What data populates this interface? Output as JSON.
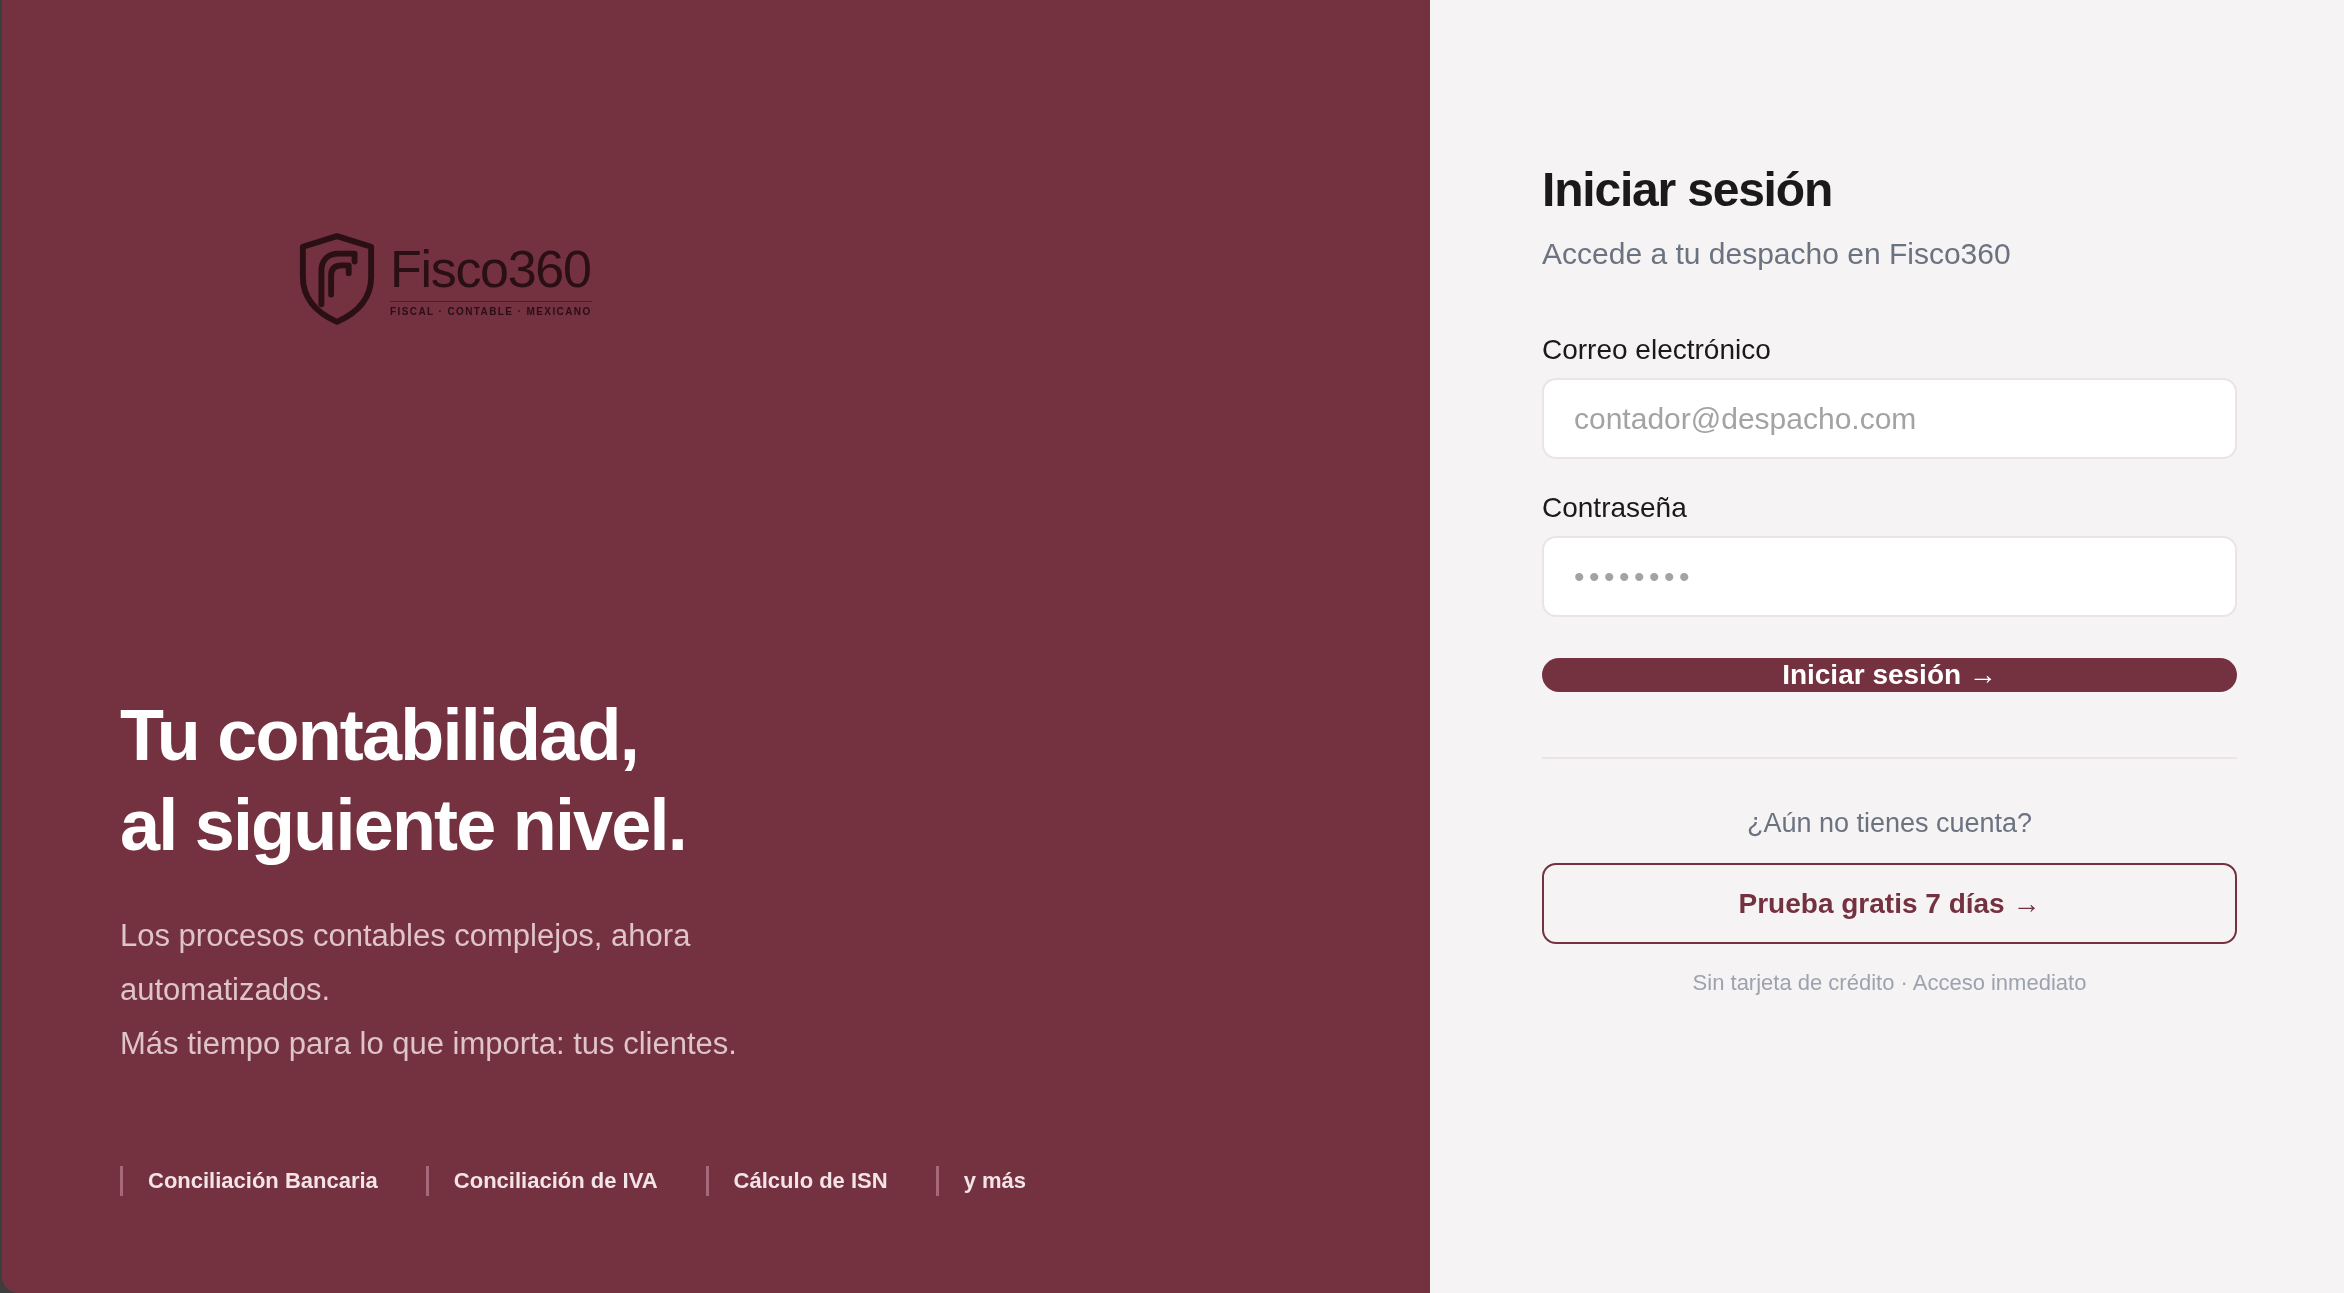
{
  "brand": {
    "wordmark": "Fisco360",
    "tagline": "FISCAL · CONTABLE · MEXICANO"
  },
  "hero": {
    "headline": [
      "Tu contabilidad,",
      "al siguiente nivel."
    ],
    "description": [
      "Los procesos contables complejos, ahora automatizados.",
      "Más tiempo para lo que importa: tus clientes."
    ],
    "features": [
      "Conciliación Bancaria",
      "Conciliación de IVA",
      "Cálculo de ISN",
      "y más"
    ]
  },
  "login": {
    "title": "Iniciar sesión",
    "subtitle": "Accede a tu despacho en Fisco360",
    "fields": [
      {
        "kind": "email",
        "label": "Correo electrónico",
        "placeholder": "contador@despacho.com"
      },
      {
        "kind": "password",
        "label": "Contraseña",
        "placeholder": "••••••••"
      }
    ],
    "submit": "Iniciar sesión →",
    "signup_prompt": "¿Aún no tienes cuenta?",
    "trial_button": "Prueba gratis 7 días →",
    "trial_note": "Sin tarjeta de crédito · Acceso inmediato"
  }
}
